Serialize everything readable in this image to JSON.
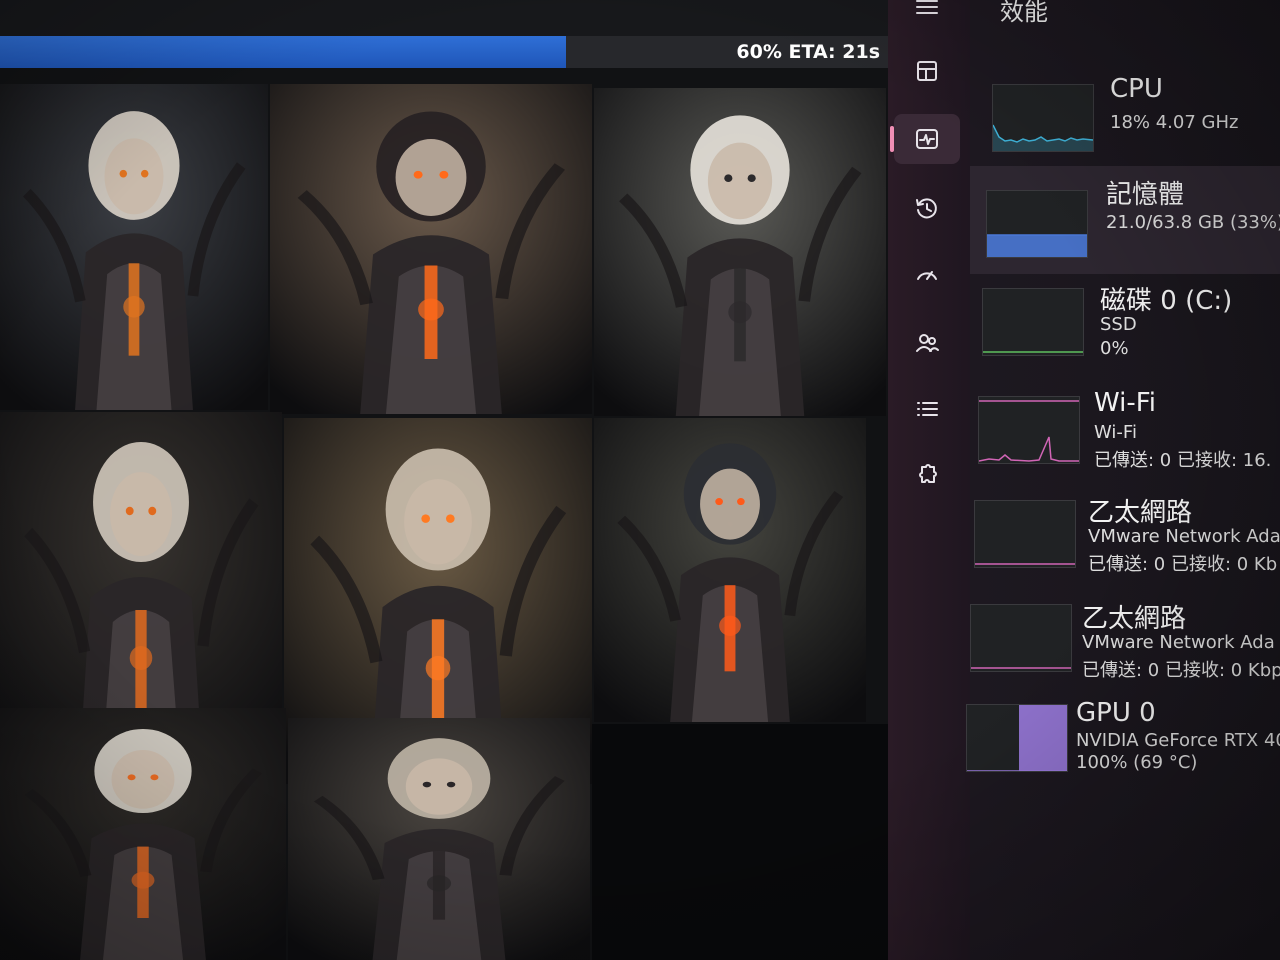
{
  "generator": {
    "progress": {
      "percent": 60,
      "label": "60% ETA: 21s"
    },
    "gallery": {
      "columns": 3,
      "thumbnails": [
        {
          "palette": [
            "#3c3f45",
            "#d9d2c6",
            "#e0731f"
          ]
        },
        {
          "palette": [
            "#6b5a4b",
            "#262022",
            "#ff6a1a"
          ]
        },
        {
          "palette": [
            "#5a5a56",
            "#e8e3dc",
            "#2c2a2c"
          ]
        },
        {
          "palette": [
            "#37332f",
            "#d0c8bb",
            "#e06a1e"
          ]
        },
        {
          "palette": [
            "#6a5a44",
            "#cbbfae",
            "#ff7a22"
          ]
        },
        {
          "palette": [
            "#45453f",
            "#2b2d33",
            "#ff5a1a"
          ]
        },
        {
          "palette": [
            "#2e2b28",
            "#dcd6cc",
            "#e86a22"
          ]
        },
        {
          "palette": [
            "#4a4540",
            "#bfb5a6",
            "#2a2628"
          ]
        }
      ],
      "empty_slot_color": "#08090b"
    }
  },
  "nav_rail": {
    "items": [
      {
        "icon": "hamburger-menu-icon"
      },
      {
        "icon": "processes-icon"
      },
      {
        "icon": "performance-icon",
        "active": true
      },
      {
        "icon": "app-history-icon"
      },
      {
        "icon": "startup-apps-icon"
      },
      {
        "icon": "users-icon"
      },
      {
        "icon": "details-icon"
      },
      {
        "icon": "services-icon"
      }
    ],
    "accent_color": "#f08fb5"
  },
  "performance": {
    "title": "效能",
    "cards": [
      {
        "name": "CPU",
        "sub": "18% 4.07 GHz",
        "stat": "",
        "graph_color": "#3fb3d9",
        "selected": false
      },
      {
        "name": "記憶體",
        "sub": "21.0/63.8 GB (33%)",
        "stat": "",
        "graph_color": "#4a78d6",
        "fill": 0.33,
        "selected": true
      },
      {
        "name": "磁碟 0 (C:)",
        "sub": "SSD",
        "stat": "0%",
        "graph_color": "#5fbf5f",
        "selected": false
      },
      {
        "name": "Wi-Fi",
        "sub": "Wi-Fi",
        "stat": "已傳送: 0 已接收: 16.",
        "graph_color": "#d065b5",
        "selected": false
      },
      {
        "name": "乙太網路",
        "sub": "VMware Network Ada",
        "stat": "已傳送: 0 已接收: 0 Kb",
        "graph_color": "#d065b5",
        "selected": false
      },
      {
        "name": "乙太網路",
        "sub": "VMware Network Ada",
        "stat": "已傳送: 0 已接收: 0 Kbp",
        "graph_color": "#d065b5",
        "selected": false
      },
      {
        "name": "GPU 0",
        "sub": "NVIDIA GeForce RTX 40",
        "stat": "100% (69 °C)",
        "graph_color": "#9b7be0",
        "fill": 1.0,
        "selected": false
      }
    ]
  }
}
